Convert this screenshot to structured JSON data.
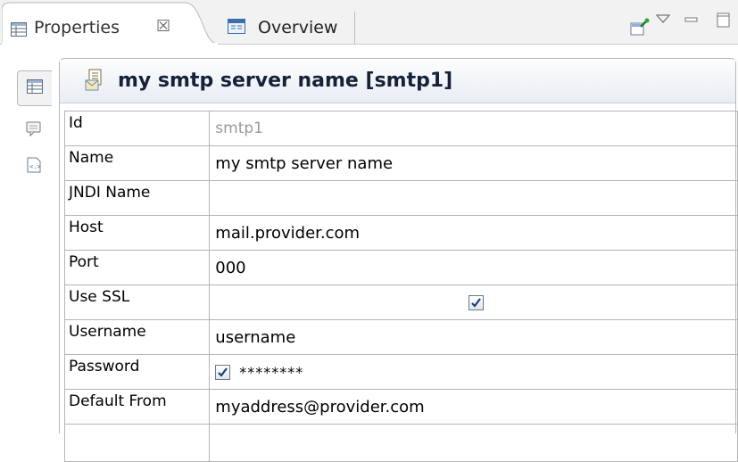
{
  "tabs": {
    "properties": {
      "label": "Properties",
      "close_glyph": "☒"
    },
    "overview": {
      "label": "Overview"
    }
  },
  "toolbar": {
    "pin_icon": "pin-icon",
    "menu_icon": "view-menu-icon",
    "minimize_icon": "minimize-icon",
    "maximize_icon": "maximize-icon"
  },
  "side_tabs": [
    "properties-table-icon",
    "comment-icon",
    "xml-source-icon"
  ],
  "header": {
    "title": "my smtp server name [smtp1]"
  },
  "properties": [
    {
      "key": "Id",
      "value": "smtp1",
      "muted": true
    },
    {
      "key": "Name",
      "value": "my smtp server name"
    },
    {
      "key": "JNDI Name",
      "value": ""
    },
    {
      "key": "Host",
      "value": "mail.provider.com"
    },
    {
      "key": "Port",
      "value": "000"
    },
    {
      "key": "Use SSL",
      "checked": true
    },
    {
      "key": "Username",
      "value": "username"
    },
    {
      "key": "Password",
      "masked_value": "********",
      "checked": true
    },
    {
      "key": "Default From",
      "value": "myaddress@provider.com"
    }
  ],
  "colors": {
    "header_text": "#15233a",
    "checkmark": "#1f3f7a",
    "border": "#b5b5b5"
  }
}
